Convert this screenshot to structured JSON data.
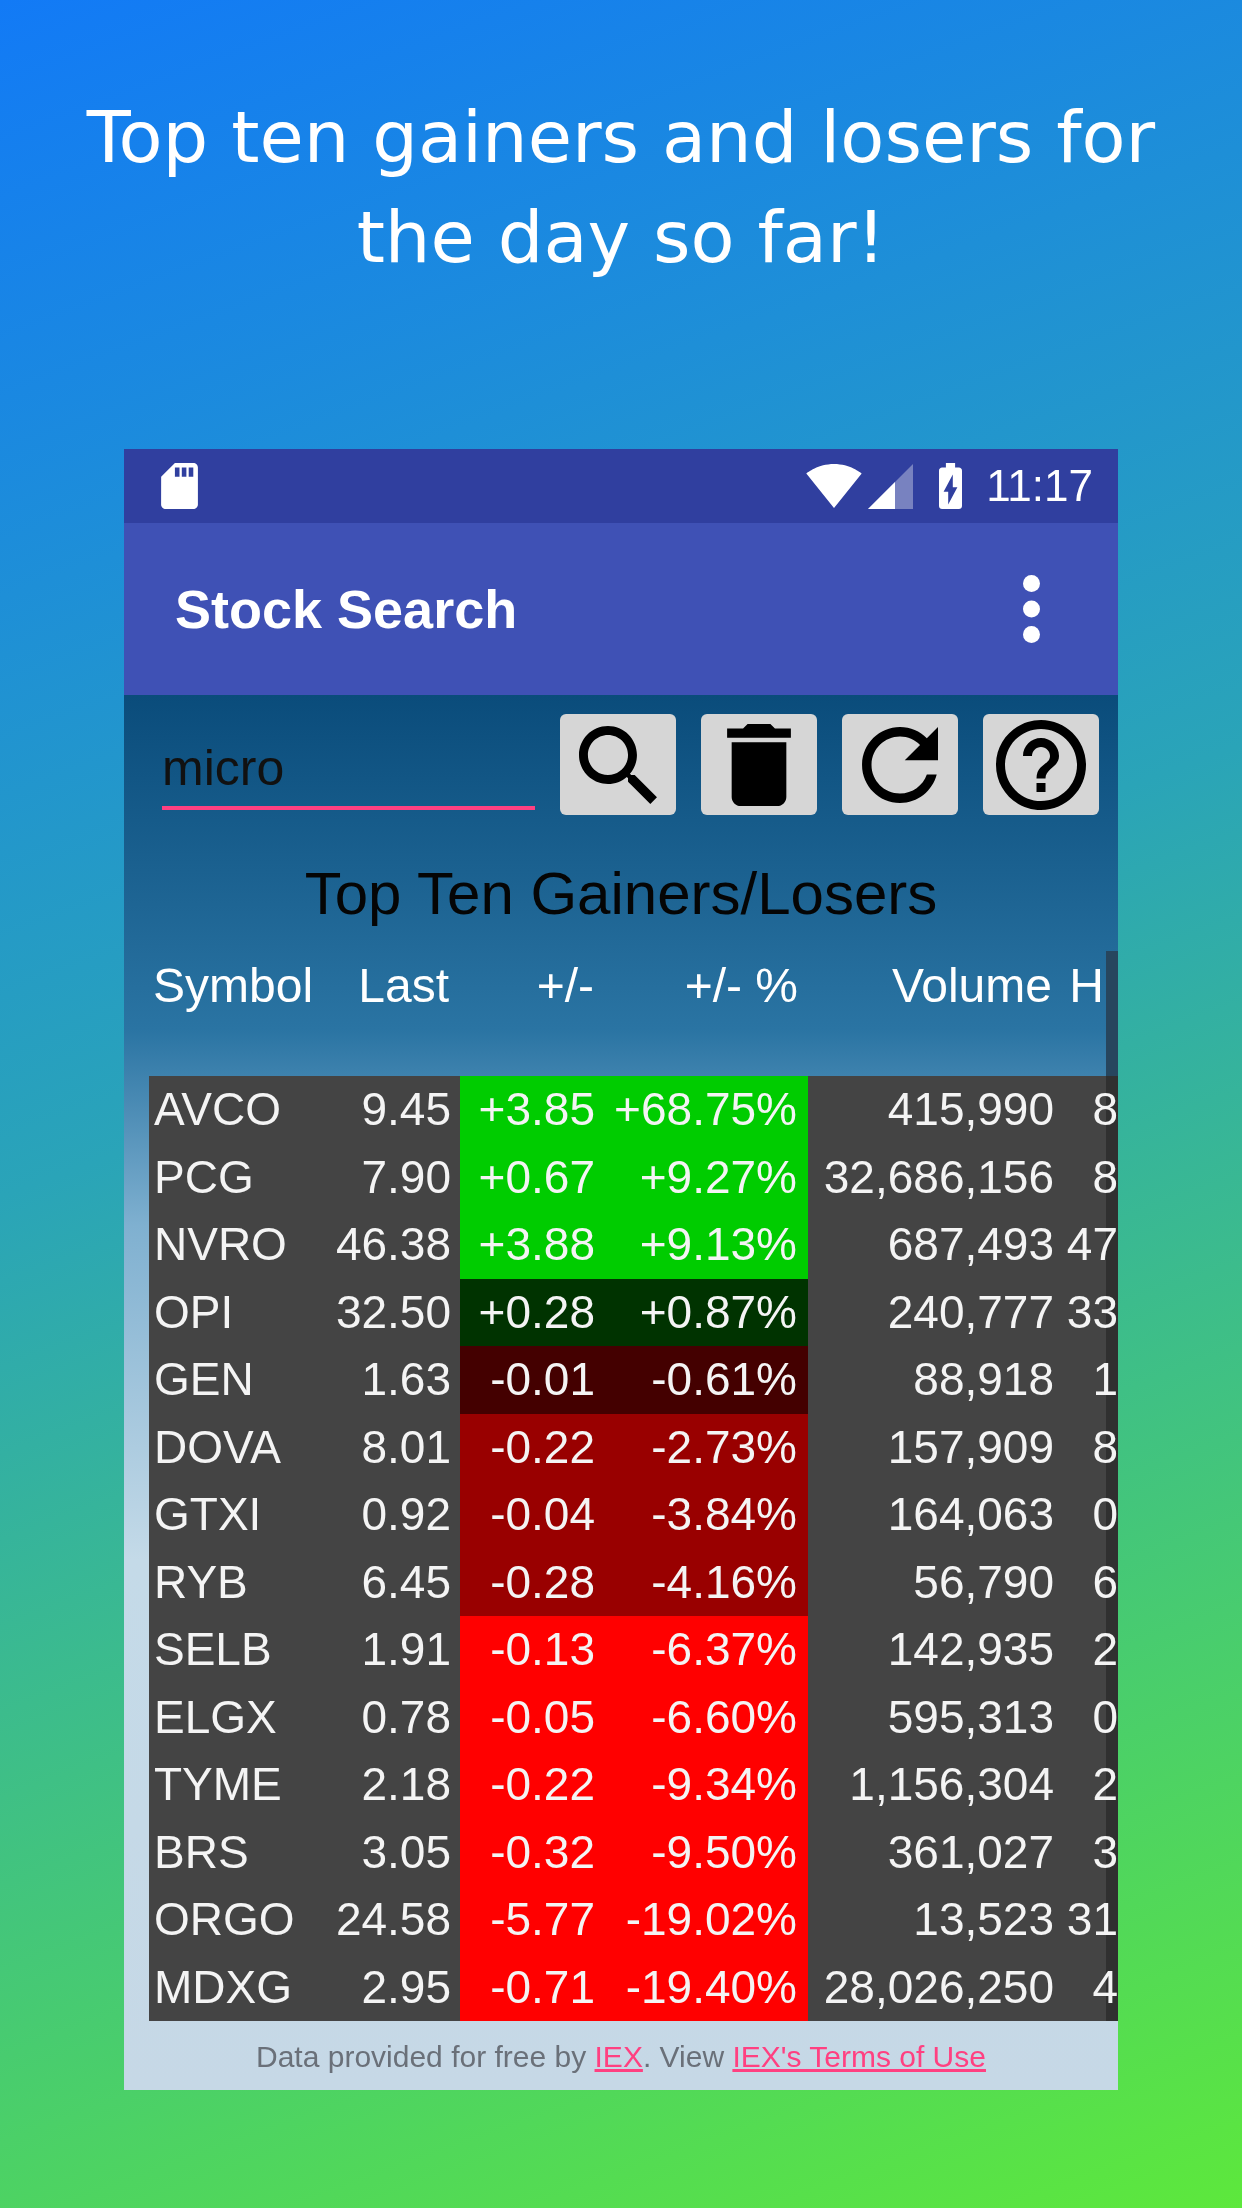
{
  "headline": "Top ten gainers and losers for the day so far!",
  "status_bar": {
    "time": "11:17"
  },
  "app_bar": {
    "title": "Stock Search"
  },
  "search": {
    "value": "micro"
  },
  "table": {
    "title": "Top Ten Gainers/Losers",
    "columns": [
      "Symbol",
      "Last",
      "+/-",
      "+/- %",
      "Volume",
      "H"
    ],
    "rows": [
      {
        "symbol": "AVCO",
        "last": "9.45",
        "change": "+3.85",
        "change_pct": "+68.75%",
        "volume": "415,990",
        "column_6": "8",
        "color": "#00cc00"
      },
      {
        "symbol": "PCG",
        "last": "7.90",
        "change": "+0.67",
        "change_pct": "+9.27%",
        "volume": "32,686,156",
        "column_6": "8",
        "color": "#00cc00"
      },
      {
        "symbol": "NVRO",
        "last": "46.38",
        "change": "+3.88",
        "change_pct": "+9.13%",
        "volume": "687,493",
        "column_6": "47",
        "color": "#00cc00"
      },
      {
        "symbol": "OPI",
        "last": "32.50",
        "change": "+0.28",
        "change_pct": "+0.87%",
        "volume": "240,777",
        "column_6": "33",
        "color": "#003300"
      },
      {
        "symbol": "GEN",
        "last": "1.63",
        "change": "-0.01",
        "change_pct": "-0.61%",
        "volume": "88,918",
        "column_6": "1",
        "color": "#440000"
      },
      {
        "symbol": "DOVA",
        "last": "8.01",
        "change": "-0.22",
        "change_pct": "-2.73%",
        "volume": "157,909",
        "column_6": "8",
        "color": "#990000"
      },
      {
        "symbol": "GTXI",
        "last": "0.92",
        "change": "-0.04",
        "change_pct": "-3.84%",
        "volume": "164,063",
        "column_6": "0",
        "color": "#990000"
      },
      {
        "symbol": "RYB",
        "last": "6.45",
        "change": "-0.28",
        "change_pct": "-4.16%",
        "volume": "56,790",
        "column_6": "6",
        "color": "#990000"
      },
      {
        "symbol": "SELB",
        "last": "1.91",
        "change": "-0.13",
        "change_pct": "-6.37%",
        "volume": "142,935",
        "column_6": "2",
        "color": "#ff0000"
      },
      {
        "symbol": "ELGX",
        "last": "0.78",
        "change": "-0.05",
        "change_pct": "-6.60%",
        "volume": "595,313",
        "column_6": "0",
        "color": "#ff0000"
      },
      {
        "symbol": "TYME",
        "last": "2.18",
        "change": "-0.22",
        "change_pct": "-9.34%",
        "volume": "1,156,304",
        "column_6": "2",
        "color": "#ff0000"
      },
      {
        "symbol": "BRS",
        "last": "3.05",
        "change": "-0.32",
        "change_pct": "-9.50%",
        "volume": "361,027",
        "column_6": "3",
        "color": "#ff0000"
      },
      {
        "symbol": "ORGO",
        "last": "24.58",
        "change": "-5.77",
        "change_pct": "-19.02%",
        "volume": "13,523",
        "column_6": "31",
        "color": "#ff0000"
      },
      {
        "symbol": "MDXG",
        "last": "2.95",
        "change": "-0.71",
        "change_pct": "-19.40%",
        "volume": "28,026,250",
        "column_6": "4",
        "color": "#ff0000"
      }
    ]
  },
  "footer": {
    "parts": [
      {
        "kind": "text",
        "text": "Data provided for free by "
      },
      {
        "kind": "link",
        "text": "IEX"
      },
      {
        "kind": "text",
        "text": ". View "
      },
      {
        "kind": "link",
        "text": "IEX's Terms of Use"
      }
    ]
  }
}
